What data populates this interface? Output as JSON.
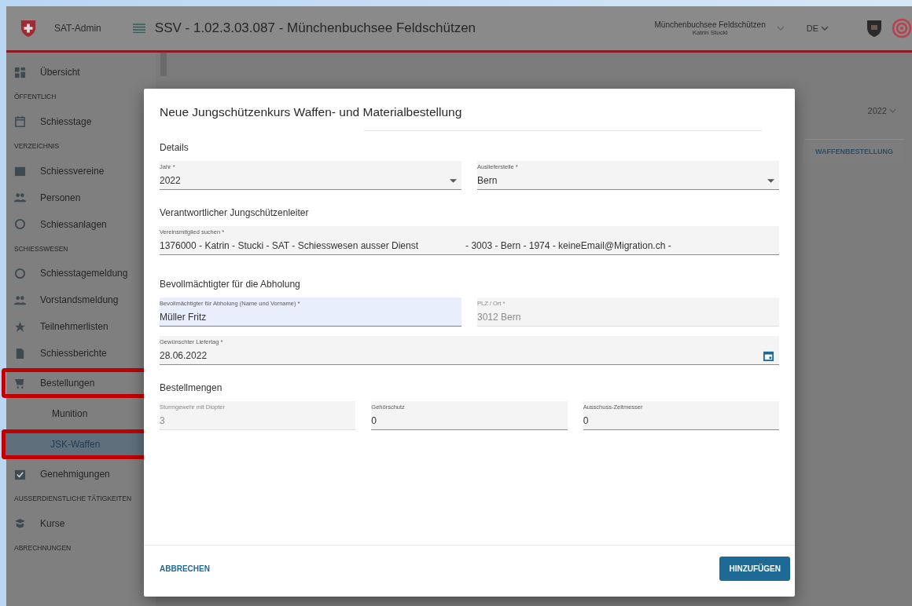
{
  "topbar": {
    "app_name": "SAT-Admin",
    "title": "SSV - 1.02.3.03.087 - Münchenbuchsee Feldschützen",
    "org": "Münchenbuchsee Feldschützen",
    "user": "Katrin Stucki",
    "language": "DE"
  },
  "sidebar": {
    "items": [
      {
        "kind": "item",
        "label": "Übersicht",
        "selected": false,
        "highlighted": false
      },
      {
        "kind": "section",
        "label": "ÖFFENTLICH"
      },
      {
        "kind": "item",
        "label": "Schiesstage",
        "selected": false,
        "highlighted": false
      },
      {
        "kind": "section",
        "label": "VERZEICHNIS"
      },
      {
        "kind": "item",
        "label": "Schiessvereine",
        "selected": false,
        "highlighted": false
      },
      {
        "kind": "item",
        "label": "Personen",
        "selected": false,
        "highlighted": false
      },
      {
        "kind": "item",
        "label": "Schiessanlagen",
        "selected": false,
        "highlighted": false
      },
      {
        "kind": "section",
        "label": "SCHIESSWESEN"
      },
      {
        "kind": "item",
        "label": "Schiesstagemeldung",
        "selected": false,
        "highlighted": false
      },
      {
        "kind": "item",
        "label": "Vorstandsmeldung",
        "selected": false,
        "highlighted": false
      },
      {
        "kind": "item",
        "label": "Teilnehmerlisten",
        "selected": false,
        "highlighted": false
      },
      {
        "kind": "item",
        "label": "Schiessberichte",
        "selected": false,
        "highlighted": false
      },
      {
        "kind": "item",
        "label": "Bestellungen",
        "selected": false,
        "highlighted": true
      },
      {
        "kind": "subitem",
        "label": "Munition",
        "selected": false,
        "highlighted": false
      },
      {
        "kind": "subitem",
        "label": "JSK-Waffen",
        "selected": true,
        "highlighted": true
      },
      {
        "kind": "item",
        "label": "Genehmigungen",
        "selected": false,
        "highlighted": false
      },
      {
        "kind": "section",
        "label": "AUSSERDIENSTLICHE TÄTIGKEITEN"
      },
      {
        "kind": "item",
        "label": "Kurse",
        "selected": false,
        "highlighted": false
      },
      {
        "kind": "section",
        "label": "ABRECHNUNGEN"
      }
    ]
  },
  "page": {
    "year": "2022",
    "action": "WAFFENBESTELLUNG"
  },
  "dialog": {
    "title": "Neue Jungschützenkurs Waffen- und Materialbestellung",
    "sections": [
      {
        "heading": "Details",
        "fields": [
          {
            "kind": "select",
            "label": "Jahr *",
            "value": "2022",
            "disabled": false,
            "focused": false
          },
          {
            "kind": "select",
            "label": "Auslieferstelle *",
            "value": "Bern",
            "disabled": false,
            "focused": false
          }
        ]
      },
      {
        "heading": "Verantwortlicher Jungschützenleiter",
        "fields": [
          {
            "kind": "text",
            "label": "Vereinsmitglied suchen *",
            "value": "1376000 - Katrin - Stucki - SAT - Schiesswesen ausser Dienst                  - 3003 - Bern - 1974 - keineEmail@Migration.ch -",
            "disabled": false,
            "focused": false
          }
        ]
      },
      {
        "heading": "Bevollmächtigter für die Abholung",
        "fields": [
          {
            "kind": "text",
            "label": "Bevollmächtigter für Abholung (Name und Vorname) *",
            "value": "Müller Fritz",
            "disabled": false,
            "focused": true
          },
          {
            "kind": "text",
            "label": "PLZ / Ort *",
            "value": "3012 Bern",
            "disabled": true,
            "focused": false
          },
          {
            "kind": "date",
            "label": "Gewünschter Liefertag *",
            "value": "28.06.2022",
            "disabled": false,
            "focused": false
          }
        ]
      },
      {
        "heading": "Bestellmengen",
        "fields": [
          {
            "kind": "text",
            "label": "Sturmgewehr mit Diopter",
            "value": "3",
            "disabled": true,
            "focused": false
          },
          {
            "kind": "text",
            "label": "Gehörschutz",
            "value": "0",
            "disabled": false,
            "focused": false
          },
          {
            "kind": "text",
            "label": "Ausschuss-Zeitmesser",
            "value": "0",
            "disabled": false,
            "focused": false
          }
        ]
      }
    ],
    "cancel": "ABBRECHEN",
    "submit": "HINZUFÜGEN"
  }
}
